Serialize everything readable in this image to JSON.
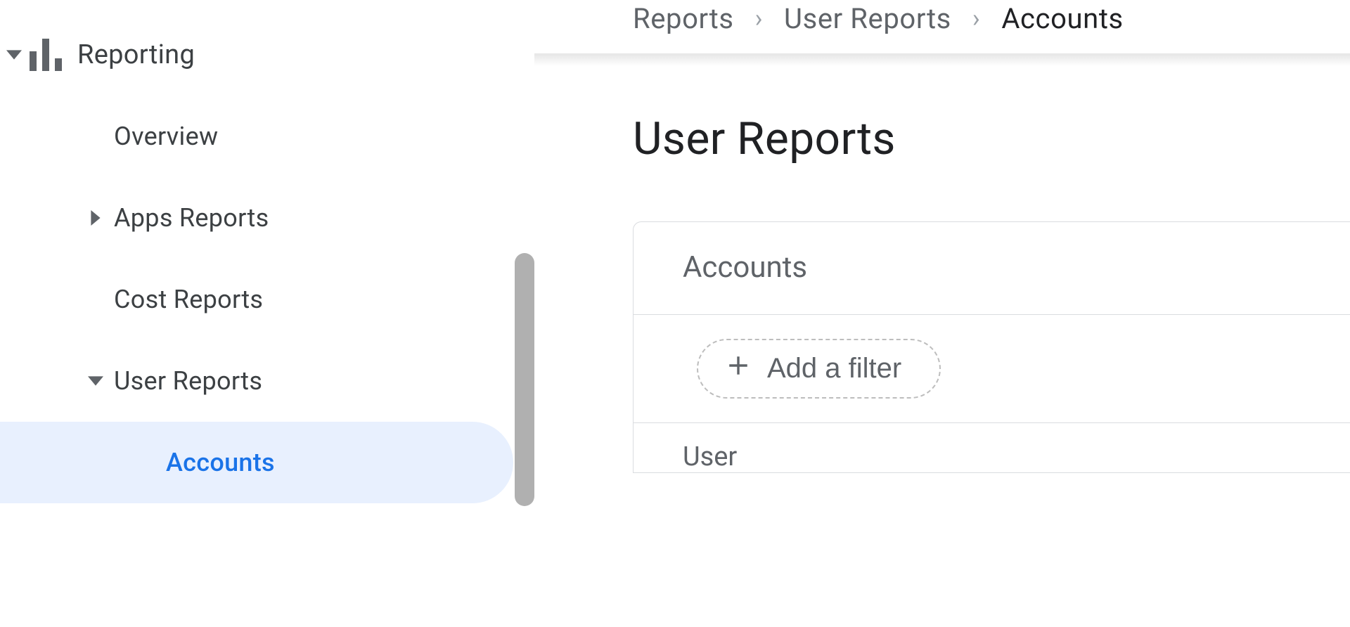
{
  "sidebar": {
    "reporting": {
      "label": "Reporting",
      "items": {
        "overview": {
          "label": "Overview"
        },
        "apps_reports": {
          "label": "Apps Reports"
        },
        "cost_reports": {
          "label": "Cost Reports"
        },
        "user_reports": {
          "label": "User Reports",
          "children": {
            "accounts": {
              "label": "Accounts",
              "active": true
            }
          }
        }
      }
    }
  },
  "breadcrumbs": {
    "reports": "Reports",
    "user_reports": "User Reports",
    "accounts": "Accounts"
  },
  "main": {
    "page_title": "User Reports",
    "card_title": "Accounts",
    "add_filter_label": "Add a filter",
    "table_first_column": "User"
  }
}
